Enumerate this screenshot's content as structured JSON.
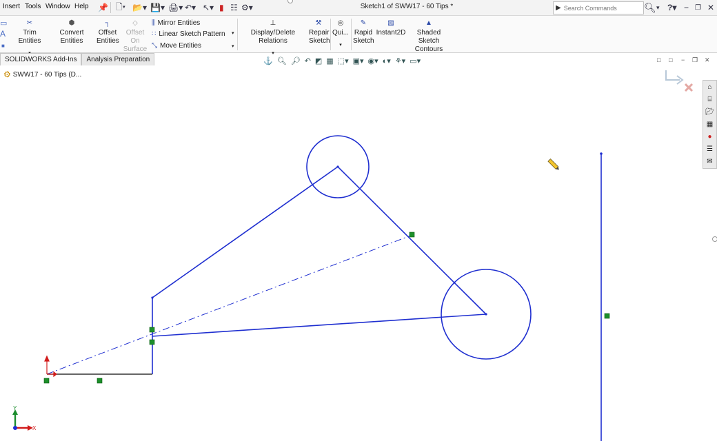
{
  "menu": {
    "insert": "Insert",
    "tools": "Tools",
    "window": "Window",
    "help": "Help"
  },
  "title": "Sketch1 of SWW17 - 60 Tips *",
  "search": {
    "placeholder": "Search Commands"
  },
  "ribbon": {
    "trim": "Trim Entities",
    "convert": "Convert Entities",
    "offset_1": "Offset",
    "offset_2": "Entities",
    "offset_surface_1": "Offset On",
    "offset_surface_2": "Surface",
    "mirror": "Mirror Entities",
    "linear_pattern": "Linear Sketch Pattern",
    "move": "Move Entities",
    "display_relations": "Display/Delete Relations",
    "repair_1": "Repair",
    "repair_2": "Sketch",
    "quick": "Qui...",
    "rapid_1": "Rapid",
    "rapid_2": "Sketch",
    "instant2d": "Instant2D",
    "shaded_1": "Shaded Sketch",
    "shaded_2": "Contours"
  },
  "tabs": [
    {
      "label": "SOLIDWORKS Add-Ins"
    },
    {
      "label": "Analysis Preparation"
    }
  ],
  "tree": {
    "root": "SWW17 - 60 Tips  (D..."
  },
  "triad": {
    "x": "X",
    "y": "Y"
  },
  "colors": {
    "sketch": "#1f2fd0",
    "relation": "#1d8f2a",
    "origin": "#d11c1c",
    "triad_x": "#d11c1c",
    "triad_y": "#1c8d2e"
  }
}
